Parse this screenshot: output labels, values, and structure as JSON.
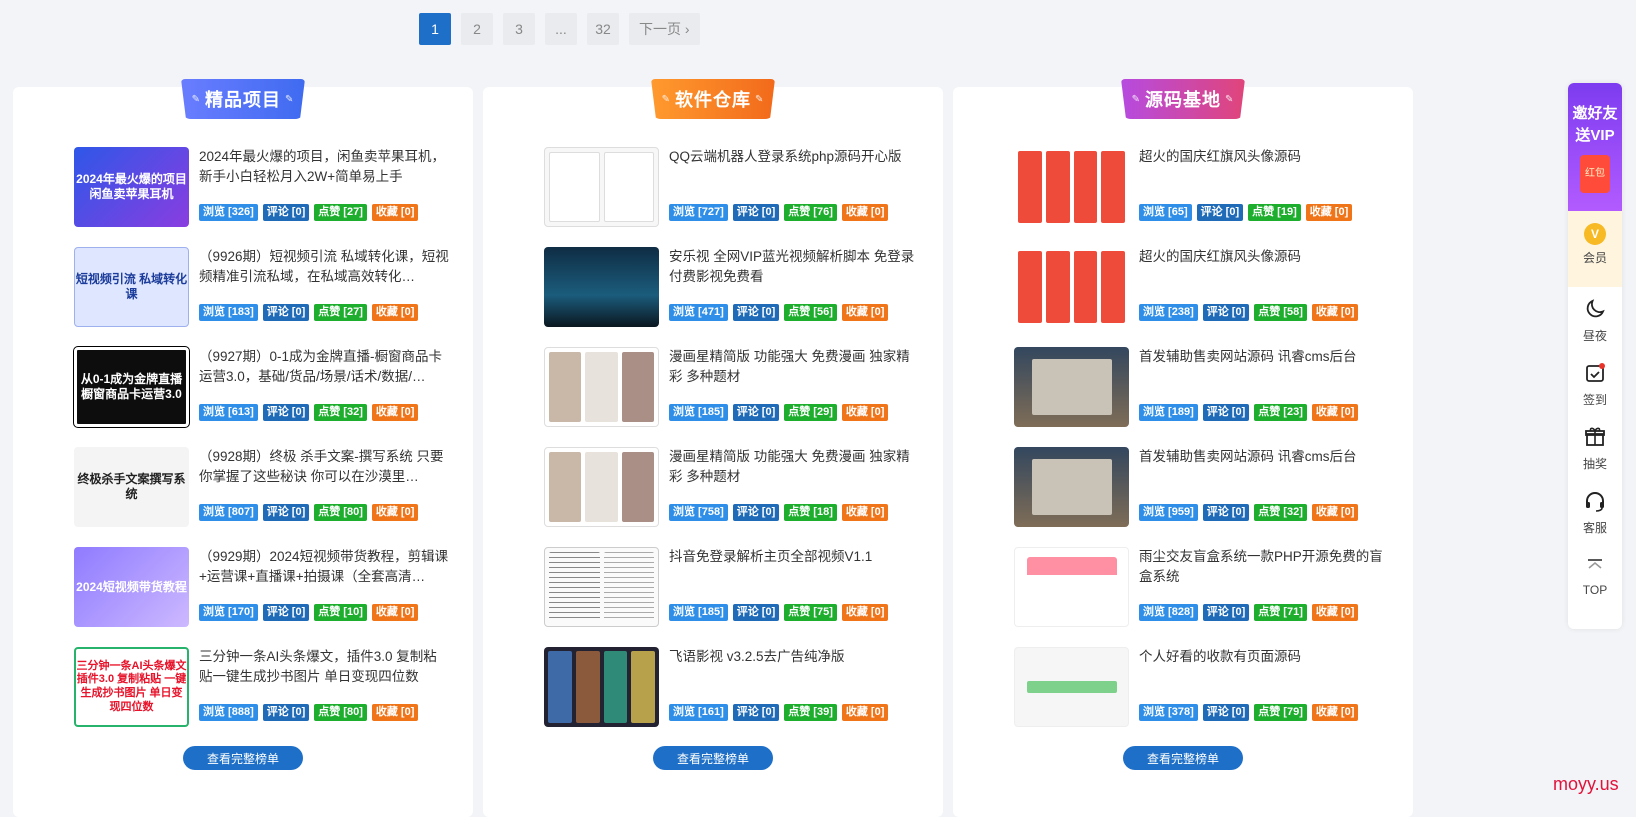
{
  "pagination": {
    "pages": [
      "1",
      "2",
      "3",
      "...",
      "32"
    ],
    "next": "下一页 ›"
  },
  "panels": [
    {
      "title": "精品项目",
      "ribbon_color": "#4e74f5",
      "more": "查看完整榜单",
      "items": [
        {
          "thumb_text": "2024年最火爆的项目 闲鱼卖苹果耳机",
          "title": "2024年最火爆的项目，闲鱼卖苹果耳机，新手小白轻松月入2W+简单易上手",
          "view": "浏览 [326]",
          "comment": "评论 [0]",
          "like": "点赞 [27]",
          "fav": "收藏 [0]"
        },
        {
          "thumb_text": "短视频引流 私域转化课",
          "title": "（9926期）短视频引流 私域转化课，短视频精准引流私域，在私域高效转化…",
          "view": "浏览 [183]",
          "comment": "评论 [0]",
          "like": "点赞 [27]",
          "fav": "收藏 [0]"
        },
        {
          "thumb_text": "从0-1成为金牌直播 橱窗商品卡运营3.0",
          "title": "（9927期）0-1成为金牌直播-橱窗商品卡运营3.0，基础/货品/场景/话术/数据/…",
          "view": "浏览 [613]",
          "comment": "评论 [0]",
          "like": "点赞 [32]",
          "fav": "收藏 [0]"
        },
        {
          "thumb_text": "终极杀手文案撰写系统",
          "title": "（9928期）终极 杀手文案-撰写系统 只要你掌握了这些秘诀 你可以在沙漠里…",
          "view": "浏览 [807]",
          "comment": "评论 [0]",
          "like": "点赞 [80]",
          "fav": "收藏 [0]"
        },
        {
          "thumb_text": "2024短视频带货教程",
          "title": "（9929期）2024短视频带货教程，剪辑课+运营课+直播课+拍摄课（全套高清…",
          "view": "浏览 [170]",
          "comment": "评论 [0]",
          "like": "点赞 [10]",
          "fav": "收藏 [0]"
        },
        {
          "thumb_text": "三分钟一条AI头条爆文 插件3.0 复制粘贴 一键生成抄书图片 单日变现四位数",
          "title": "三分钟一条AI头条爆文，插件3.0 复制粘贴一键生成抄书图片 单日变现四位数",
          "view": "浏览 [888]",
          "comment": "评论 [0]",
          "like": "点赞 [80]",
          "fav": "收藏 [0]"
        }
      ]
    },
    {
      "title": "软件仓库",
      "ribbon_color": "#f7841f",
      "more": "查看完整榜单",
      "items": [
        {
          "thumb_text": "",
          "title": "QQ云端机器人登录系统php源码开心版",
          "view": "浏览 [727]",
          "comment": "评论 [0]",
          "like": "点赞 [76]",
          "fav": "收藏 [0]"
        },
        {
          "thumb_text": "",
          "title": "安乐视 全网VIP蓝光视频解析脚本 免登录付费影视免费看",
          "view": "浏览 [471]",
          "comment": "评论 [0]",
          "like": "点赞 [56]",
          "fav": "收藏 [0]"
        },
        {
          "thumb_text": "",
          "title": "漫画星精简版 功能强大 免费漫画 独家精彩 多种题材",
          "view": "浏览 [185]",
          "comment": "评论 [0]",
          "like": "点赞 [29]",
          "fav": "收藏 [0]"
        },
        {
          "thumb_text": "",
          "title": "漫画星精简版 功能强大 免费漫画 独家精彩 多种题材",
          "view": "浏览 [758]",
          "comment": "评论 [0]",
          "like": "点赞 [18]",
          "fav": "收藏 [0]"
        },
        {
          "thumb_text": "",
          "title": "抖音免登录解析主页全部视频V1.1",
          "view": "浏览 [185]",
          "comment": "评论 [0]",
          "like": "点赞 [75]",
          "fav": "收藏 [0]"
        },
        {
          "thumb_text": "",
          "title": "飞语影视 v3.2.5去广告纯净版",
          "view": "浏览 [161]",
          "comment": "评论 [0]",
          "like": "点赞 [39]",
          "fav": "收藏 [0]"
        }
      ]
    },
    {
      "title": "源码基地",
      "ribbon_color": "#c446c9",
      "more": "查看完整榜单",
      "items": [
        {
          "thumb_text": "",
          "title": "超火的国庆红旗风头像源码",
          "view": "浏览 [65]",
          "comment": "评论 [0]",
          "like": "点赞 [19]",
          "fav": "收藏 [0]"
        },
        {
          "thumb_text": "",
          "title": "超火的国庆红旗风头像源码",
          "view": "浏览 [238]",
          "comment": "评论 [0]",
          "like": "点赞 [58]",
          "fav": "收藏 [0]"
        },
        {
          "thumb_text": "",
          "title": "首发辅助售卖网站源码 讯睿cms后台",
          "view": "浏览 [189]",
          "comment": "评论 [0]",
          "like": "点赞 [23]",
          "fav": "收藏 [0]"
        },
        {
          "thumb_text": "",
          "title": "首发辅助售卖网站源码 讯睿cms后台",
          "view": "浏览 [959]",
          "comment": "评论 [0]",
          "like": "点赞 [32]",
          "fav": "收藏 [0]"
        },
        {
          "thumb_text": "",
          "title": "雨尘交友盲盒系统一款PHP开源免费的盲盒系统",
          "view": "浏览 [828]",
          "comment": "评论 [0]",
          "like": "点赞 [71]",
          "fav": "收藏 [0]"
        },
        {
          "thumb_text": "",
          "title": "个人好看的收款有页面源码",
          "view": "浏览 [378]",
          "comment": "评论 [0]",
          "like": "点赞 [79]",
          "fav": "收藏 [0]"
        }
      ]
    }
  ],
  "sidebar": {
    "vip_text": "邀好友送VIP",
    "packet_text": "红包",
    "member_icon": "v-badge-icon",
    "member_badge": "V",
    "member": "会员",
    "night_icon": "moon-icon",
    "night": "昼夜",
    "checkin_icon": "calendar-check-icon",
    "checkin": "签到",
    "lottery_icon": "gift-icon",
    "lottery": "抽奖",
    "service_icon": "headset-icon",
    "service": "客服",
    "top_icon": "arrow-up-icon",
    "top": "TOP"
  },
  "watermark": "moyy.us"
}
